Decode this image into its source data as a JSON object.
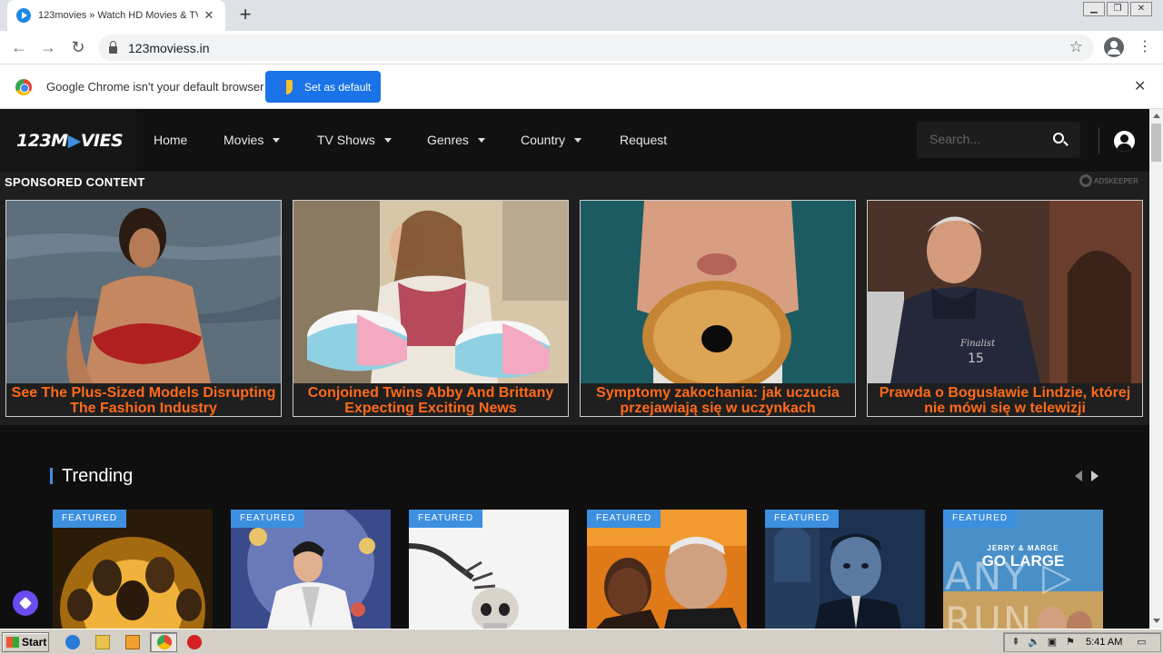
{
  "browser": {
    "tab_title": "123movies » Watch HD Movies & TV",
    "tab_close": "✕",
    "new_tab": "+",
    "url": "123moviess.in",
    "infobar_text": "Google Chrome isn't your default browser",
    "set_default_label": "Set as default",
    "infobar_close": "✕",
    "window_buttons": [
      "▁",
      "❐",
      "✕"
    ]
  },
  "site": {
    "logo_main": "123M",
    "logo_accent": "▶",
    "logo_rest": "VIES",
    "nav": [
      {
        "label": "Home",
        "dropdown": false
      },
      {
        "label": "Movies",
        "dropdown": true
      },
      {
        "label": "TV Shows",
        "dropdown": true
      },
      {
        "label": "Genres",
        "dropdown": true
      },
      {
        "label": "Country",
        "dropdown": true
      },
      {
        "label": "Request",
        "dropdown": false
      }
    ],
    "search_placeholder": "Search..."
  },
  "sponsored": {
    "title": "SPONSORED CONTENT",
    "provider": "ADSKEEPER",
    "ads": [
      {
        "caption": "See The Plus-Sized Models Disrupting The Fashion Industry"
      },
      {
        "caption": "Conjoined Twins Abby And Brittany Expecting Exciting News"
      },
      {
        "caption": "Symptomy zakochania: jak uczucia przejawiają się w uczynkach"
      },
      {
        "caption": "Prawda o Bogusławie Lindzie, której nie mówi się w telewizji"
      }
    ]
  },
  "trending": {
    "title": "Trending",
    "badge": "FEATURED",
    "last_poster_small": "JERRY & MARGE",
    "last_poster_big": "GO LARGE"
  },
  "watermark": "ANY ▷ RUN",
  "taskbar": {
    "start_label": "Start",
    "clock": "5:41 AM"
  },
  "colors": {
    "accent": "#3d8fe0",
    "ad_caption": "#ff6a1a",
    "chrome_blue": "#1a73e8"
  }
}
